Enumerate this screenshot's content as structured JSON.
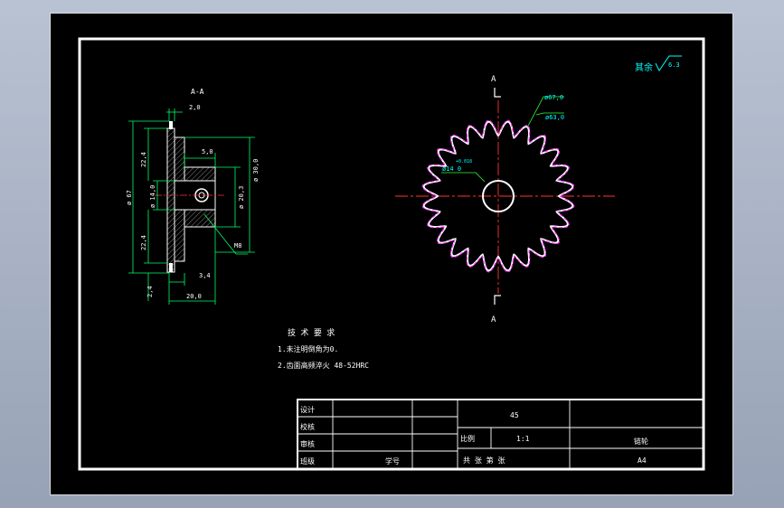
{
  "colors": {
    "background": "#000000",
    "outer_bg": "#a6b0c3",
    "border": "#ffffff",
    "dimension": "#00ff66",
    "centerline": "#ff3333",
    "geometry": "#ffffff",
    "chain_path": "#ff33ff",
    "hatch": "#dddddd",
    "annotation": "#00ffff",
    "leader": "#33ff33"
  },
  "section": {
    "label": "A-A",
    "dims": {
      "hub_width": "2,0",
      "bore_depth": "5,0",
      "hub_dia": "ø 30,0",
      "bore_dia": "ø 20,3",
      "upper_tooth": "22,4",
      "bore_center": "ø 14,0",
      "lower_tooth": "22,4",
      "pitch_dia": "ø 67",
      "offset": "3,4",
      "tooth_bottom": "2,4",
      "total_width": "20,0",
      "keyhole": "M8"
    }
  },
  "front_view": {
    "cut_label_top": "A",
    "cut_label_bottom": "A",
    "outer_dia": "ø67,0",
    "root_dia": "ø63,0",
    "bore_tol": "+0.018",
    "bore_dia": "ø14 0",
    "tooth_count": 24
  },
  "roughness": {
    "prefix": "其余",
    "value": "6.3"
  },
  "tech_notes": {
    "title": "技 术 要 求",
    "line1": "1.未注明倒角为0.",
    "line2": "2.齿面高频淬火 48-52HRC"
  },
  "title_block": {
    "design": "设计",
    "check": "校核",
    "review": "审核",
    "class": "班级",
    "student_no": "学号",
    "material": "45",
    "scale_label": "比例",
    "scale_value": "1:1",
    "part_name": "链轮",
    "sheets": "共     张 第     张",
    "sheet_size": "A4"
  }
}
